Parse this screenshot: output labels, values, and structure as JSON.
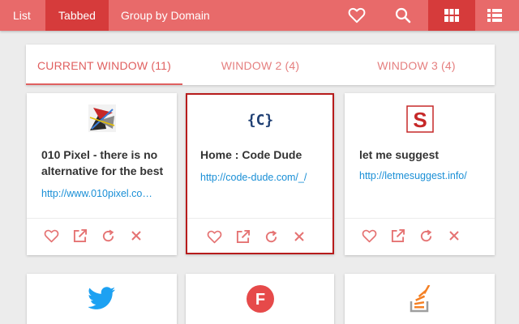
{
  "nav": {
    "list_label": "List",
    "tabbed_label": "Tabbed",
    "group_label": "Group by Domain"
  },
  "tabs": [
    {
      "label": "CURRENT WINDOW (11)",
      "active": true
    },
    {
      "label": "WINDOW 2 (4)",
      "active": false
    },
    {
      "label": "WINDOW 3 (4)",
      "active": false
    }
  ],
  "cards": [
    {
      "title": "010 Pixel - there is no alternative for the best",
      "url": "http://www.010pixel.co…",
      "icon": "010pixel-favicon",
      "selected": false
    },
    {
      "title": "Home : Code Dude",
      "url": "http://code-dude.com/_/",
      "icon": "codedude-favicon",
      "selected": true
    },
    {
      "title": "let me suggest",
      "url": "http://letmesuggest.info/",
      "icon": "letmesuggest-favicon",
      "selected": false
    },
    {
      "icon": "twitter-favicon"
    },
    {
      "icon": "f-circle-favicon"
    },
    {
      "icon": "stackoverflow-favicon"
    }
  ],
  "colors": {
    "accent": "#e86a6a",
    "accent_dark": "#d63b3b",
    "selected_border": "#b71c1c",
    "link": "#1a8fd6",
    "action_icon": "#e57373"
  }
}
